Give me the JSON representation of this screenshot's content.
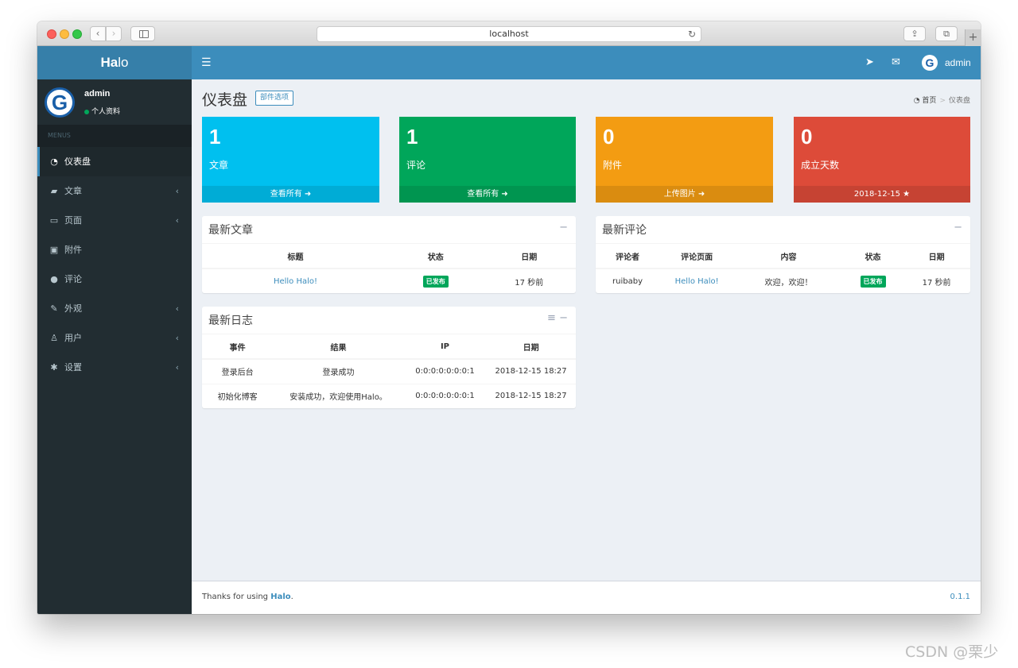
{
  "browser": {
    "url": "localhost"
  },
  "colors": {
    "accent": "#3c8dbc",
    "aqua": "#00c0ef",
    "green": "#00a65a",
    "yellow": "#f39c12",
    "red": "#dd4b39",
    "sidebar": "#222d32"
  },
  "logo": {
    "bold": "Ha",
    "rest": "lo"
  },
  "topnav": {
    "user": "admin",
    "avatar_letter": "G"
  },
  "sidebar": {
    "user_name": "admin",
    "user_status": "个人资料",
    "menu_header": "MENUS",
    "items": [
      {
        "label": "仪表盘",
        "icon": "dashboard-icon"
      },
      {
        "label": "文章",
        "icon": "book-icon"
      },
      {
        "label": "页面",
        "icon": "desktop-icon"
      },
      {
        "label": "附件",
        "icon": "image-icon"
      },
      {
        "label": "评论",
        "icon": "comment-icon"
      },
      {
        "label": "外观",
        "icon": "brush-icon"
      },
      {
        "label": "用户",
        "icon": "user-icon"
      },
      {
        "label": "设置",
        "icon": "cog-icon"
      }
    ]
  },
  "page": {
    "title": "仪表盘",
    "widget_button": "部件选项",
    "breadcrumb": {
      "home": "首页",
      "current": "仪表盘"
    }
  },
  "stats": [
    {
      "value": "1",
      "label": "文章",
      "footer": "查看所有",
      "color": "#00c0ef"
    },
    {
      "value": "1",
      "label": "评论",
      "footer": "查看所有",
      "color": "#00a65a"
    },
    {
      "value": "0",
      "label": "附件",
      "footer": "上传图片",
      "color": "#f39c12"
    },
    {
      "value": "0",
      "label": "成立天数",
      "footer": "2018-12-15",
      "color": "#dd4b39"
    }
  ],
  "latest_posts": {
    "title": "最新文章",
    "headers": [
      "标题",
      "状态",
      "日期"
    ],
    "rows": [
      {
        "title": "Hello Halo!",
        "status": "已发布",
        "date": "17 秒前"
      }
    ]
  },
  "latest_comments": {
    "title": "最新评论",
    "headers": [
      "评论者",
      "评论页面",
      "内容",
      "状态",
      "日期"
    ],
    "rows": [
      {
        "author": "ruibaby",
        "page": "Hello Halo!",
        "content": "欢迎，欢迎！",
        "status": "已发布",
        "date": "17 秒前"
      }
    ]
  },
  "latest_logs": {
    "title": "最新日志",
    "headers": [
      "事件",
      "结果",
      "IP",
      "日期"
    ],
    "rows": [
      {
        "event": "登录后台",
        "result": "登录成功",
        "ip": "0:0:0:0:0:0:0:1",
        "date": "2018-12-15 18:27"
      },
      {
        "event": "初始化博客",
        "result": "安装成功，欢迎使用Halo。",
        "ip": "0:0:0:0:0:0:0:1",
        "date": "2018-12-15 18:27"
      }
    ]
  },
  "footer": {
    "prefix": "Thanks for using",
    "brand": "Halo",
    "suffix": ".",
    "version": "0.1.1"
  },
  "watermark": "CSDN @栗少"
}
